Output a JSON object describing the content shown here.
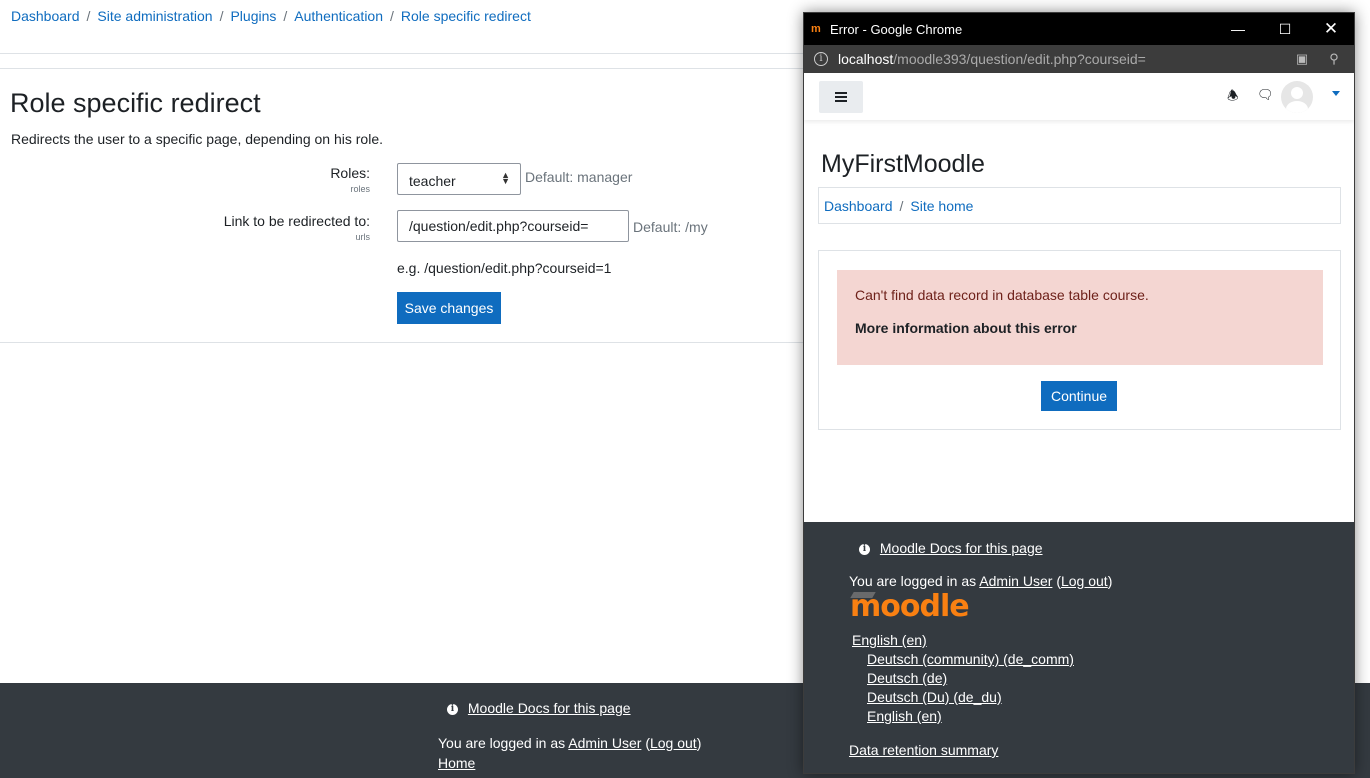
{
  "background": {
    "breadcrumb": [
      "Dashboard",
      "Site administration",
      "Plugins",
      "Authentication",
      "Role specific redirect"
    ],
    "page_title": "Role specific redirect",
    "description": "Redirects the user to a specific page, depending on his role.",
    "form": {
      "roles_label": "Roles:",
      "roles_sub": "roles",
      "roles_value": "teacher",
      "roles_default": "Default: manager",
      "link_label": "Link to be redirected to:",
      "link_sub": "urls",
      "link_value": "/question/edit.php?courseid=",
      "link_default": "Default: /my",
      "example": "e.g. /question/edit.php?courseid=1",
      "save_label": "Save changes"
    },
    "footer": {
      "docs_link": "Moodle Docs for this page",
      "logged_in_prefix": "You are logged in as",
      "user_name": "Admin User",
      "logout": "Log out",
      "home": "Home"
    }
  },
  "popup": {
    "window_title": "Error - Google Chrome",
    "url_host": "localhost",
    "url_path": "/moodle393/question/edit.php?courseid=",
    "site_title": "MyFirstMoodle",
    "breadcrumb": [
      "Dashboard",
      "Site home"
    ],
    "error_message": "Can't find data record in database table course.",
    "more_info": "More information about this error",
    "continue_label": "Continue",
    "footer": {
      "docs_link": "Moodle Docs for this page",
      "logged_in_prefix": "You are logged in as",
      "user_name": "Admin User",
      "logout": "Log out",
      "logo_text": "moodle",
      "current_language": "English (en)",
      "languages": [
        "Deutsch (community) (de_comm)",
        "Deutsch (de)",
        "Deutsch (Du) (de_du)",
        "English (en)"
      ],
      "data_retention": "Data retention summary"
    }
  },
  "colors": {
    "link": "#0f6cbf",
    "primary_button": "#0f6cbf",
    "footer_bg": "#343a40",
    "alert_bg": "#f4d6d2",
    "moodle_orange": "#f98012"
  },
  "icons": {
    "info": "info-icon",
    "bell": "bell-icon",
    "chat": "chat-icon",
    "menu": "hamburger-icon",
    "translate": "translate-icon",
    "zoom": "zoom-icon"
  }
}
